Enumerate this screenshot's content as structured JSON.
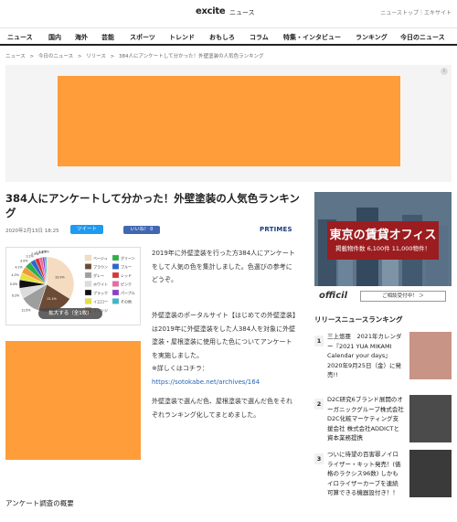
{
  "header": {
    "logo_text": "excite",
    "logo_sub": "ニュース",
    "top_links": "ニューストップ｜エキサイト"
  },
  "nav": [
    {
      "label": "ニュース"
    },
    {
      "label": "国内"
    },
    {
      "label": "海外"
    },
    {
      "label": "芸能"
    },
    {
      "label": "スポーツ"
    },
    {
      "label": "トレンド"
    },
    {
      "label": "おもしろ"
    },
    {
      "label": "コラム"
    },
    {
      "label": "特集・インタビュー"
    },
    {
      "label": "ランキング"
    },
    {
      "label": "今日のニュース"
    }
  ],
  "breadcrumb": [
    "ニュース",
    ">",
    "今日のニュース",
    ">",
    "リリース",
    ">",
    "384人にアンケートして分かった！外壁塗装の人気色ランキング"
  ],
  "article": {
    "title": "384人にアンケートして分かった！外壁塗装の人気色ランキング",
    "date": "2020年2月13日 18:25",
    "tweet_label": "ツイート",
    "fb_label": "いいね！ 0",
    "source": "PRTIMES",
    "image_button": "拡大する（全1枚）",
    "para1": "2019年に外壁塗装を行った方384人にアンケートをして人気の色を集計しました。色選びの参考にどうぞ。",
    "para2": "外壁塗装のポータルサイト【はじめての外壁塗装】は2019年に外壁塗装をした人384人を対象に外壁塗装・屋根塗装に使用した色についてアンケートを実施しました。",
    "para3_prefix": "※詳しくはコチラ：",
    "para3_link": "https://sotokabe.net/archives/164",
    "para4": "外壁塗装で選んだ色、屋根塗装で選んだ色をそれぞれランキング化してまとめました。",
    "sub_heading": "アンケート調査の概要"
  },
  "chart_data": {
    "type": "pie",
    "series": [
      {
        "name": "ベージュ",
        "value": 33.9,
        "color": "#f5dcc0"
      },
      {
        "name": "ブラウン",
        "value": 21.1,
        "color": "#6b4a36"
      },
      {
        "name": "グレー",
        "value": 11.5,
        "color": "#9e9e9e"
      },
      {
        "name": "ホワイト",
        "value": 6.2,
        "color": "#dcdcdc"
      },
      {
        "name": "ブラック",
        "value": 5.0,
        "color": "#111111"
      },
      {
        "name": "イエロー",
        "value": 4.2,
        "color": "#e4e040"
      },
      {
        "name": "オレンジ",
        "value": 4.1,
        "color": "#f29a36"
      },
      {
        "name": "グリーン",
        "value": 3.9,
        "color": "#2fae4b"
      },
      {
        "name": "ブルー",
        "value": 3.1,
        "color": "#2b66d1"
      },
      {
        "name": "レッド",
        "value": 2.5,
        "color": "#d93434"
      },
      {
        "name": "ピンク",
        "value": 2.0,
        "color": "#e86aa4"
      },
      {
        "name": "パープル",
        "value": 1.3,
        "color": "#8a3fc6"
      },
      {
        "name": "その他",
        "value": 1.2,
        "color": "#39b8c8"
      }
    ],
    "slice_labels": [
      "33.9%",
      "21.1%",
      "11.5%",
      "6.2%",
      "5.0%",
      "4.2%",
      "4.1%",
      "3.9%",
      "3.1%",
      "2.5%",
      "2.0%",
      "1.3%",
      "1.2%"
    ]
  },
  "sidebar": {
    "ad_title": "東京の賃貸オフィス",
    "ad_sub": "掲載物件数 6,100件 11,000物件！",
    "ad_logo": "officil",
    "ad_button": "ご相談受付中！ ＞",
    "rank_heading": "リリースニュースランキング",
    "rank_items": [
      {
        "num": "1",
        "text": "三上悠亜　2021年カレンダー『2021 YUA MIKAMI Calendar your days』2020年9月25日（金）に発売!!",
        "thumb_color": "#c79486"
      },
      {
        "num": "2",
        "text": "D2C研究6ブランド展開のオーガニックグループ株式会社D2C化粧マーケティング支援会社 株式会社ADDICTと資本業務提携",
        "thumb_color": "#4b4b4b"
      },
      {
        "num": "3",
        "text": "ついに待望の百害罪ノイロライザー・キット発売！(価格のラクシス96数) しかもイロライザーカーブを連続可算できる機器設付き！！",
        "thumb_color": "#3a3a3a"
      }
    ]
  }
}
